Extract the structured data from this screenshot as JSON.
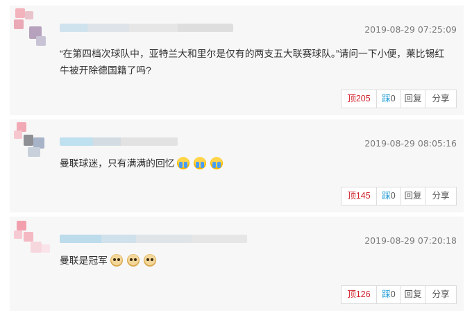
{
  "comments": [
    {
      "time": "2019-08-29 07:25:09",
      "text": "“在第四档次球队中，亚特兰大和里尔是仅有的两支五大联赛球队。”请问一下小便，莱比锡红牛被开除德国籍了吗?",
      "emojis": [],
      "actions": {
        "up_label": "顶",
        "up_count": "205",
        "down_label": "踩",
        "down_count": "0",
        "reply": "回复",
        "share": "分享"
      }
    },
    {
      "time": "2019-08-29 08:05:16",
      "text": "曼联球迷，只有满满的回忆",
      "emojis": [
        "crying-emoji",
        "crying-emoji",
        "crying-emoji"
      ],
      "actions": {
        "up_label": "顶",
        "up_count": "145",
        "down_label": "踩",
        "down_count": "0",
        "reply": "回复",
        "share": "分享"
      }
    },
    {
      "time": "2019-08-29 07:20:18",
      "text": "曼联是冠军",
      "emojis": [
        "doge-emoji",
        "doge-emoji",
        "doge-emoji"
      ],
      "actions": {
        "up_label": "顶",
        "up_count": "126",
        "down_label": "踩",
        "down_count": "0",
        "reply": "回复",
        "share": "分享"
      }
    }
  ],
  "colors": {
    "up": "#d0202a",
    "down": "#1f9bd4",
    "timestamp": "#7a7a7a",
    "card": "#f7f7f7"
  }
}
